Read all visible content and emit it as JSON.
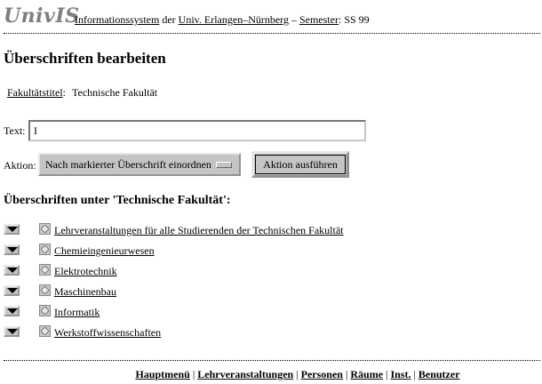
{
  "header": {
    "logo": "UnivIS",
    "info_link": "Informationssystem",
    "der": "der",
    "university_link": "Univ. Erlangen–Nürnberg",
    "dash": "–",
    "semester_link": "Semester",
    "semester_colon": ":",
    "semester_value": "SS 99"
  },
  "page": {
    "title": "Überschriften bearbeiten",
    "faculty_label": "Fakultätstitel",
    "faculty_colon": ":",
    "faculty_value": "Technische Fakultät"
  },
  "form": {
    "text_label": "Text:",
    "text_value": "I",
    "action_label": "Aktion:",
    "action_selected": "Nach markierter Überschrift einordnen",
    "submit_label": "Aktion ausführen"
  },
  "section": {
    "title": "Überschriften unter 'Technische Fakultät':"
  },
  "headings": [
    {
      "label": "Lehrveranstaltungen für alle Studierenden der Technischen Fakultät"
    },
    {
      "label": "Chemieingenieurwesen"
    },
    {
      "label": "Elektrotechnik"
    },
    {
      "label": "Maschinenbau"
    },
    {
      "label": "Informatik"
    },
    {
      "label": "Werkstoffwissenschaften"
    }
  ],
  "footer": {
    "links": [
      "Hauptmenü",
      "Lehrveranstaltungen",
      "Personen",
      "Räume",
      "Inst.",
      "Benutzer"
    ],
    "separator": "|"
  },
  "icons": {
    "move": "triangle-down-icon",
    "select": "diamond-checkbox-icon"
  },
  "colors": {
    "logo": "#7f7f7f",
    "widget_gray": "#c4c4c4"
  }
}
